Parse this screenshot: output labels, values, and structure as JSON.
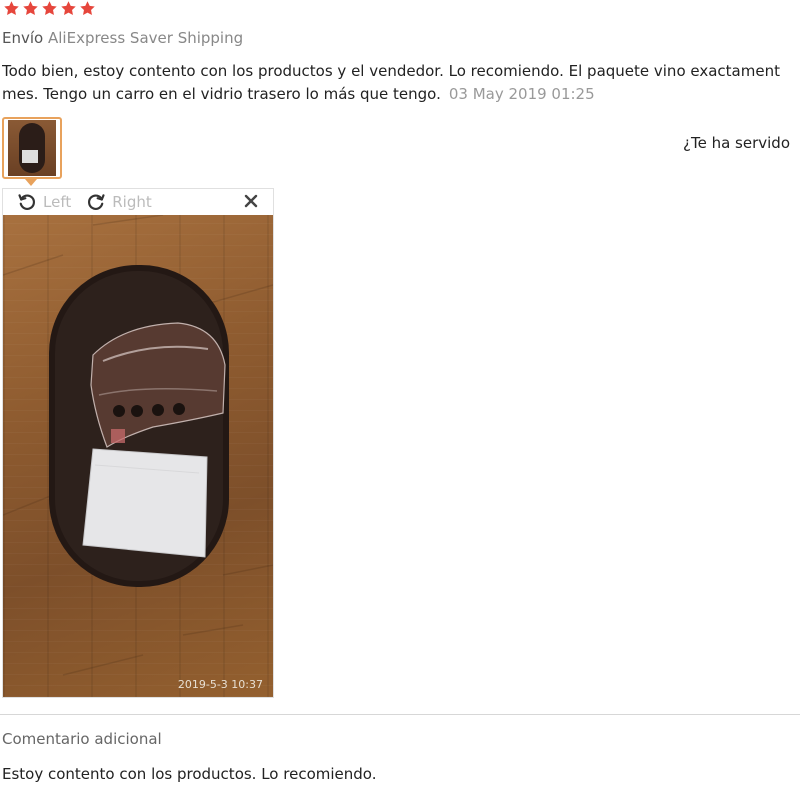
{
  "review": {
    "rating": 5,
    "rating_color": "#e6463c",
    "shipping_label": "Envío",
    "shipping_value": "AliExpress Saver Shipping",
    "text_line1": "Todo bien, estoy contento con los productos y el vendedor. Lo recomiendo. El paquete vino exactament",
    "text_line2": "mes. Tengo un carro en el vidrio trasero lo más que tengo.",
    "date": "03 May 2019 01:25",
    "helpful_prompt": "¿Te ha servido"
  },
  "viewer": {
    "rotate_left_label": "Left",
    "rotate_right_label": "Right",
    "close_icon": "close-icon",
    "photo_timestamp": "2019-5-3 10:37"
  },
  "additional": {
    "title": "Comentario adicional",
    "text": "Estoy contento con los productos. Lo recomiendo."
  },
  "colors": {
    "thumb_border": "#e8a25c",
    "muted_text": "#999999"
  }
}
